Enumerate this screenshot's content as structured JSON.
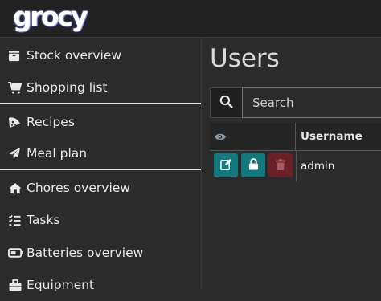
{
  "app": {
    "logo_text": "grocy"
  },
  "sidebar": {
    "items": [
      {
        "label": "Stock overview",
        "icon": "box-icon"
      },
      {
        "label": "Shopping list",
        "icon": "cart-icon"
      },
      {
        "label": "Recipes",
        "icon": "pizza-icon"
      },
      {
        "label": "Meal plan",
        "icon": "paper-plane-icon"
      },
      {
        "label": "Chores overview",
        "icon": "home-icon"
      },
      {
        "label": "Tasks",
        "icon": "tasks-icon"
      },
      {
        "label": "Batteries overview",
        "icon": "battery-icon"
      },
      {
        "label": "Equipment",
        "icon": "toolbox-icon"
      }
    ]
  },
  "main": {
    "title": "Users",
    "search": {
      "placeholder": "Search"
    },
    "table": {
      "columns": [
        "",
        "Username"
      ],
      "rows": [
        {
          "username": "admin"
        }
      ]
    }
  },
  "colors": {
    "accent_teal": "#13797f",
    "danger": "#6b1f27",
    "background": "#2b2b2b"
  }
}
